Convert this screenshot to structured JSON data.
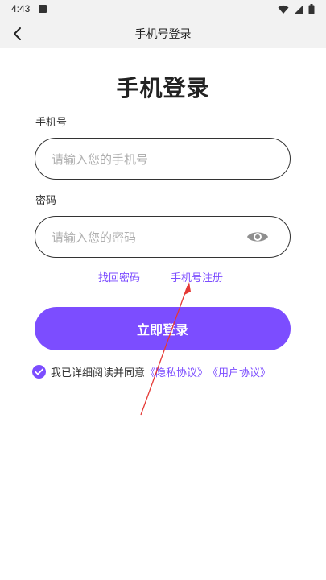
{
  "status_bar": {
    "time": "4:43"
  },
  "app_bar": {
    "title": "手机号登录"
  },
  "page": {
    "heading": "手机登录"
  },
  "phone_field": {
    "label": "手机号",
    "placeholder": "请输入您的手机号",
    "value": ""
  },
  "password_field": {
    "label": "密码",
    "placeholder": "请输入您的密码",
    "value": ""
  },
  "links": {
    "forgot_password": "找回密码",
    "register": "手机号注册"
  },
  "submit_button": {
    "label": "立即登录"
  },
  "agreement": {
    "checked": true,
    "text": "我已详细阅读并同意",
    "privacy_policy": "《隐私协议》",
    "user_agreement": "《用户协议》"
  },
  "colors": {
    "accent": "#7c4dff",
    "annotation_arrow": "#e53935",
    "bar_background": "#f2f2f2"
  },
  "icons": {
    "back": "chevron-left-icon",
    "eye": "eye-icon",
    "check": "check-icon",
    "wifi": "wifi-icon",
    "signal": "signal-icon",
    "battery": "battery-icon"
  }
}
